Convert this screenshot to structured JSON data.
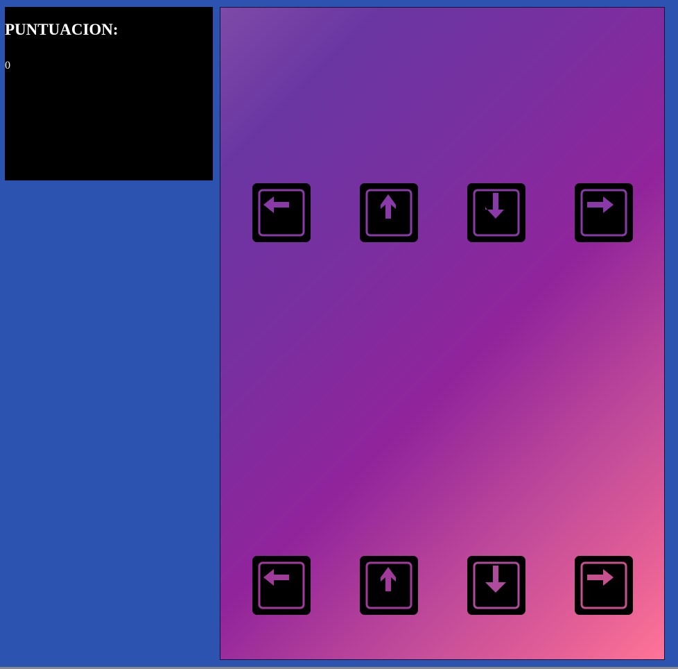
{
  "score": {
    "title": "PUNTUACION:",
    "value": "0"
  },
  "colors": {
    "page_background": "#2d53b1",
    "score_panel": "#000000",
    "gradient_start": "#7e4aa8",
    "gradient_mid": "#91249b",
    "gradient_end": "#ff7496",
    "arrow_top_row": "#8a3aa8",
    "arrow_bottom_row": "#a23a9c"
  },
  "arrow_keys": {
    "targets": [
      "left-arrow-icon",
      "up-arrow-icon",
      "down-arrow-icon",
      "right-arrow-icon"
    ],
    "notes": [
      "left-arrow-icon",
      "up-arrow-icon",
      "down-arrow-icon",
      "right-arrow-icon"
    ]
  }
}
